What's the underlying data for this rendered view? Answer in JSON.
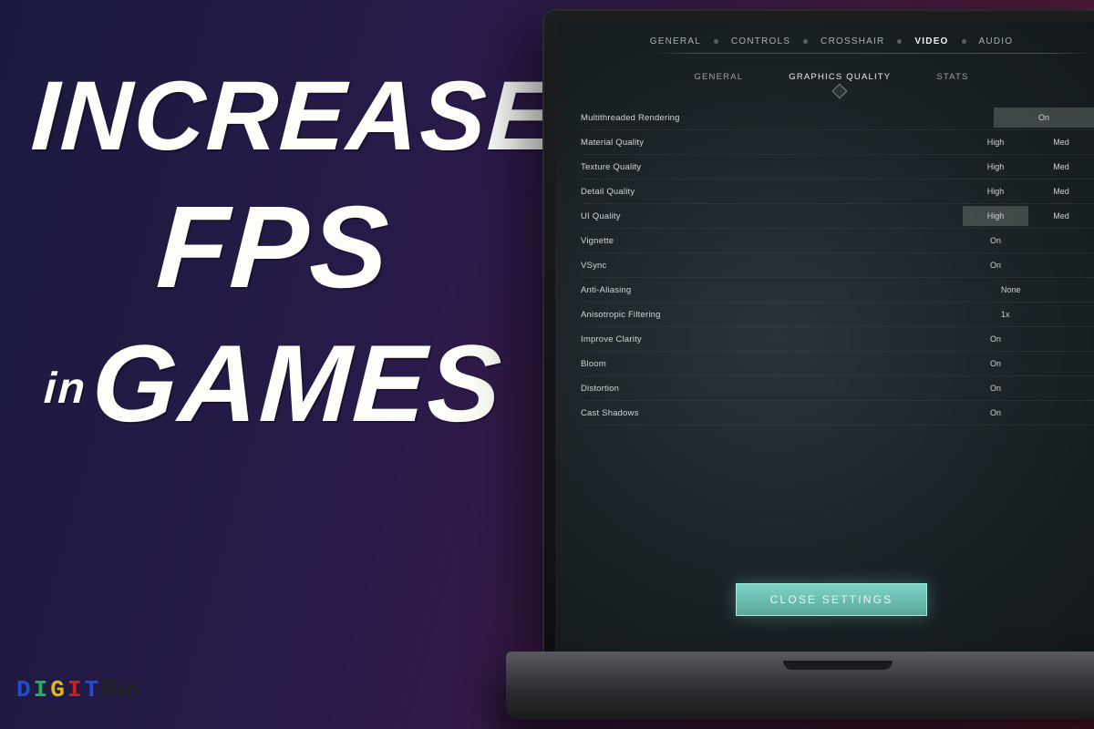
{
  "title": {
    "line1": "INCREASE",
    "line2": "FPS",
    "in": "in",
    "line3": "GAMES"
  },
  "brand": {
    "l1": "D",
    "l2": "I",
    "l3": "G",
    "l4": "I",
    "l5": "T",
    "rest": "Bin"
  },
  "top_tabs": [
    "GENERAL",
    "CONTROLS",
    "CROSSHAIR",
    "VIDEO",
    "AUDIO"
  ],
  "top_active": "VIDEO",
  "sub_tabs": [
    "GENERAL",
    "GRAPHICS QUALITY",
    "STATS"
  ],
  "sub_active": "GRAPHICS QUALITY",
  "settings": [
    {
      "label": "Multithreaded Rendering",
      "opts": [
        "On"
      ],
      "sel": 0,
      "wide": true
    },
    {
      "label": "Material Quality",
      "opts": [
        "High",
        "Med"
      ],
      "sel": -1
    },
    {
      "label": "Texture Quality",
      "opts": [
        "High",
        "Med"
      ],
      "sel": -1
    },
    {
      "label": "Detail Quality",
      "opts": [
        "High",
        "Med"
      ],
      "sel": -1
    },
    {
      "label": "UI Quality",
      "opts": [
        "High",
        "Med"
      ],
      "sel": 0
    },
    {
      "label": "Vignette",
      "opts": [
        "On",
        ""
      ],
      "sel": -1
    },
    {
      "label": "VSync",
      "opts": [
        "On",
        ""
      ],
      "sel": -1
    },
    {
      "label": "Anti-Aliasing",
      "opts": [
        "None"
      ],
      "sel": -1,
      "wide": true,
      "leftalign": true
    },
    {
      "label": "Anisotropic Filtering",
      "opts": [
        "1x"
      ],
      "sel": -1,
      "wide": true,
      "leftalign": true
    },
    {
      "label": "Improve Clarity",
      "opts": [
        "On",
        ""
      ],
      "sel": -1
    },
    {
      "label": "Bloom",
      "opts": [
        "On",
        ""
      ],
      "sel": -1
    },
    {
      "label": "Distortion",
      "opts": [
        "On",
        ""
      ],
      "sel": -1
    },
    {
      "label": "Cast Shadows",
      "opts": [
        "On",
        ""
      ],
      "sel": -1
    }
  ],
  "close_label": "CLOSE SETTINGS"
}
